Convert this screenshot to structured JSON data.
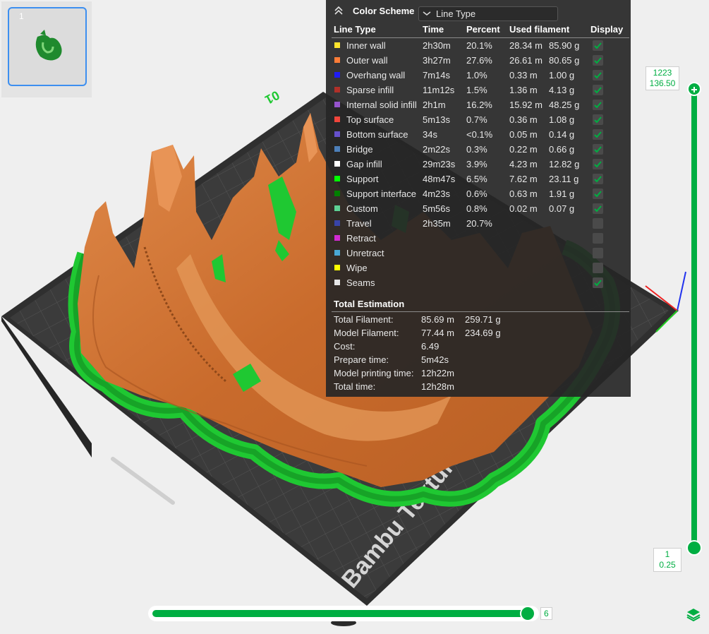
{
  "plate": {
    "number": "1"
  },
  "color_scheme": {
    "title": "Color Scheme",
    "selected": "Line Type",
    "columns": [
      "Line Type",
      "Time",
      "Percent",
      "Used filament",
      "Display"
    ],
    "rows": [
      {
        "name": "Inner wall",
        "time": "2h30m",
        "percent": "20.1%",
        "length": "28.34 m",
        "weight": "85.90 g",
        "color": "#ffe42d",
        "display": true
      },
      {
        "name": "Outer wall",
        "time": "3h27m",
        "percent": "27.6%",
        "length": "26.61 m",
        "weight": "80.65 g",
        "color": "#ff7d38",
        "display": true
      },
      {
        "name": "Overhang wall",
        "time": "7m14s",
        "percent": "1.0%",
        "length": "0.33 m",
        "weight": "1.00 g",
        "color": "#1f1cf5",
        "display": true
      },
      {
        "name": "Sparse infill",
        "time": "11m12s",
        "percent": "1.5%",
        "length": "1.36 m",
        "weight": "4.13 g",
        "color": "#b03029",
        "display": true
      },
      {
        "name": "Internal solid infill",
        "time": "2h1m",
        "percent": "16.2%",
        "length": "15.92 m",
        "weight": "48.25 g",
        "color": "#9654cc",
        "display": true
      },
      {
        "name": "Top surface",
        "time": "5m13s",
        "percent": "0.7%",
        "length": "0.36 m",
        "weight": "1.08 g",
        "color": "#f0453b",
        "display": true
      },
      {
        "name": "Bottom surface",
        "time": "34s",
        "percent": "<0.1%",
        "length": "0.05 m",
        "weight": "0.14 g",
        "color": "#6651cc",
        "display": true
      },
      {
        "name": "Bridge",
        "time": "2m22s",
        "percent": "0.3%",
        "length": "0.22 m",
        "weight": "0.66 g",
        "color": "#4d80ba",
        "display": true
      },
      {
        "name": "Gap infill",
        "time": "29m23s",
        "percent": "3.9%",
        "length": "4.23 m",
        "weight": "12.82 g",
        "color": "#ffffff",
        "display": true
      },
      {
        "name": "Support",
        "time": "48m47s",
        "percent": "6.5%",
        "length": "7.62 m",
        "weight": "23.11 g",
        "color": "#00ff00",
        "display": true
      },
      {
        "name": "Support interface",
        "time": "4m23s",
        "percent": "0.6%",
        "length": "0.63 m",
        "weight": "1.91 g",
        "color": "#008000",
        "display": true
      },
      {
        "name": "Custom",
        "time": "5m56s",
        "percent": "0.8%",
        "length": "0.02 m",
        "weight": "0.07 g",
        "color": "#5ed194",
        "display": true
      },
      {
        "name": "Travel",
        "time": "2h35m",
        "percent": "20.7%",
        "length": "",
        "weight": "",
        "color": "#3844a8",
        "display": false
      },
      {
        "name": "Retract",
        "time": "",
        "percent": "",
        "length": "",
        "weight": "",
        "color": "#d12bd1",
        "display": false
      },
      {
        "name": "Unretract",
        "time": "",
        "percent": "",
        "length": "",
        "weight": "",
        "color": "#49a9d6",
        "display": false
      },
      {
        "name": "Wipe",
        "time": "",
        "percent": "",
        "length": "",
        "weight": "",
        "color": "#ffff00",
        "display": false
      },
      {
        "name": "Seams",
        "time": "",
        "percent": "",
        "length": "",
        "weight": "",
        "color": "#e6e6e6",
        "display": true
      }
    ]
  },
  "total_estimation": {
    "title": "Total Estimation",
    "rows": [
      {
        "label": "Total Filament:",
        "value": "85.69 m",
        "value2": "259.71 g"
      },
      {
        "label": "Model Filament:",
        "value": "77.44 m",
        "value2": "234.69 g"
      },
      {
        "label": "Cost:",
        "value": "6.49",
        "value2": ""
      },
      {
        "label": "Prepare time:",
        "value": "5m42s",
        "value2": ""
      },
      {
        "label": "Model printing time:",
        "value": "12h22m",
        "value2": ""
      },
      {
        "label": "Total time:",
        "value": "12h28m",
        "value2": ""
      }
    ]
  },
  "layer_slider": {
    "top_layer": "1223",
    "top_height": "136.50",
    "bottom_layer": "1",
    "bottom_height": "0.25"
  },
  "move_slider": {
    "value": "6",
    "position_fraction": 1.0
  },
  "plate_text": {
    "brand": "Bambu Textured PEI Plate",
    "corner_label": "01"
  },
  "colors": {
    "accent": "#00ae42",
    "model": "#d2763a",
    "support": "#1fc832",
    "plate": "#3a3a3a"
  }
}
